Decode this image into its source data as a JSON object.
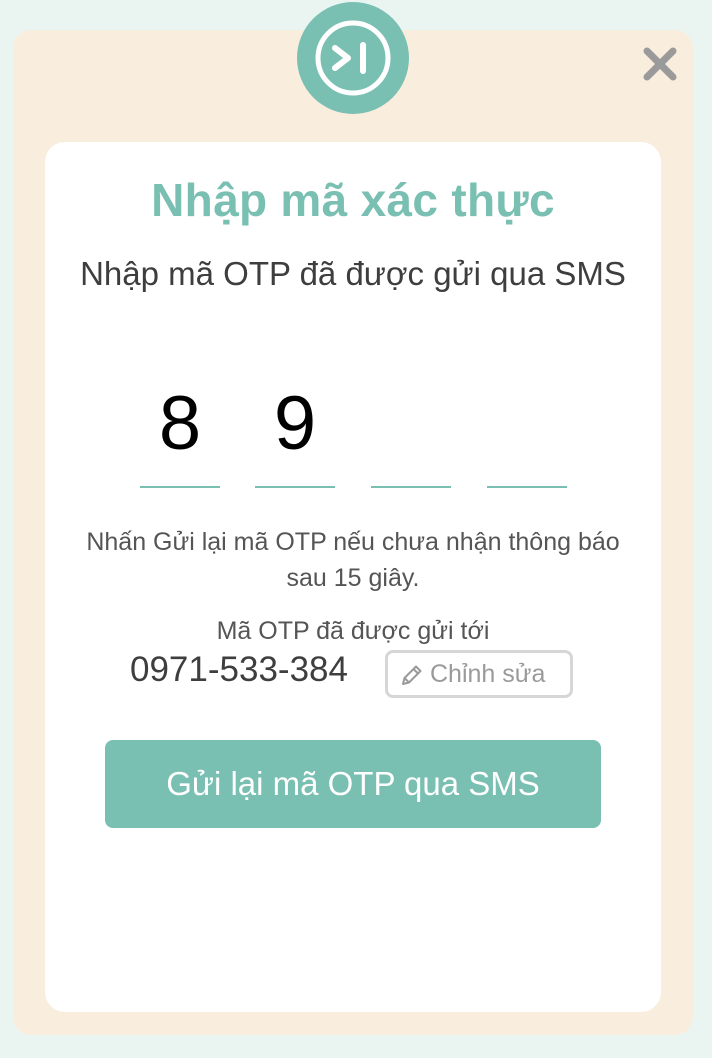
{
  "header": {
    "logo_icon": "skip-forward-logo-icon",
    "logo_glyph": ">I",
    "close_icon": "close-icon"
  },
  "dialog": {
    "title": "Nhập mã xác thực",
    "subtitle": "Nhập mã OTP đã được gửi qua SMS",
    "otp_digits": [
      "8",
      "9",
      "",
      ""
    ],
    "hint": "Nhấn Gửi lại mã OTP nếu chưa nhận thông báo sau 15 giây.",
    "sent_label": "Mã OTP đã được gửi tới",
    "phone": "0971-533-384",
    "edit_label": "Chỉnh sửa",
    "edit_icon": "pencil-icon",
    "resend_label": "Gửi lại mã OTP qua SMS"
  },
  "colors": {
    "accent": "#79bfb2",
    "modal_background": "#f9eedd",
    "page_background": "#eaf5f2",
    "card_background": "#ffffff",
    "text_dark": "#3e3e3e",
    "text_muted": "#555555"
  }
}
